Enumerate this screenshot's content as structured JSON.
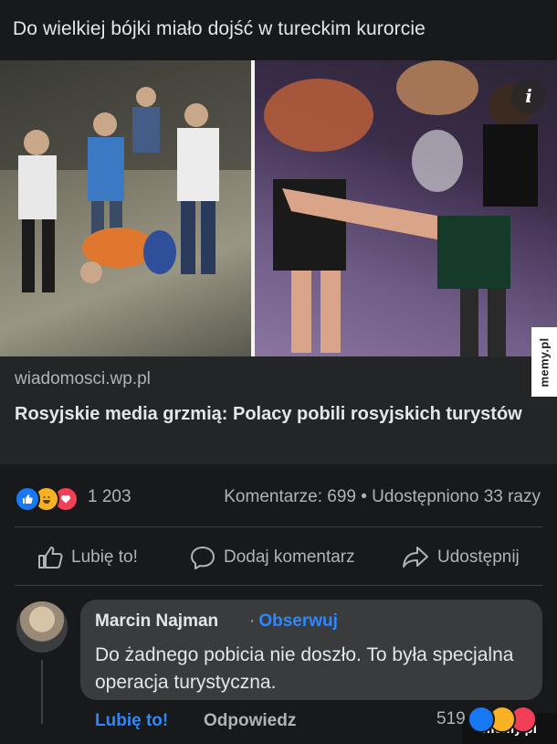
{
  "post": {
    "text": "Do wielkiej bójki miało dojść w tureckim kurorcie"
  },
  "link_preview": {
    "domain": "wiadomosci.wp.pl",
    "title": "Rosyjskie media grzmią: Polacy pobili rosyjskich turystów",
    "info_icon": "i"
  },
  "stats": {
    "reaction_icons": [
      "like-icon",
      "haha-icon",
      "love-icon"
    ],
    "reaction_count": "1 203",
    "comments_shares": "Komentarze: 699 • Udostępniono 33 razy"
  },
  "actions": {
    "like_label": "Lubię to!",
    "comment_label": "Dodaj komentarz",
    "share_label": "Udostępnij"
  },
  "comment": {
    "author": "Marcin Najman",
    "separator": "·",
    "follow_label": "Obserwuj",
    "body": "Do żadnego pobicia nie doszło. To była specjalna operacja turystyczna.",
    "like_label": "Lubię to!",
    "reply_label": "Odpowiedz",
    "reaction_count": "519"
  },
  "watermarks": {
    "side": "memy.pl",
    "bottom": "memy.pl"
  },
  "colors": {
    "background": "#18191a",
    "card": "#242526",
    "bubble": "#3a3b3c",
    "accent_blue": "#2d88ff",
    "secondary_text": "#b0b3b8"
  }
}
